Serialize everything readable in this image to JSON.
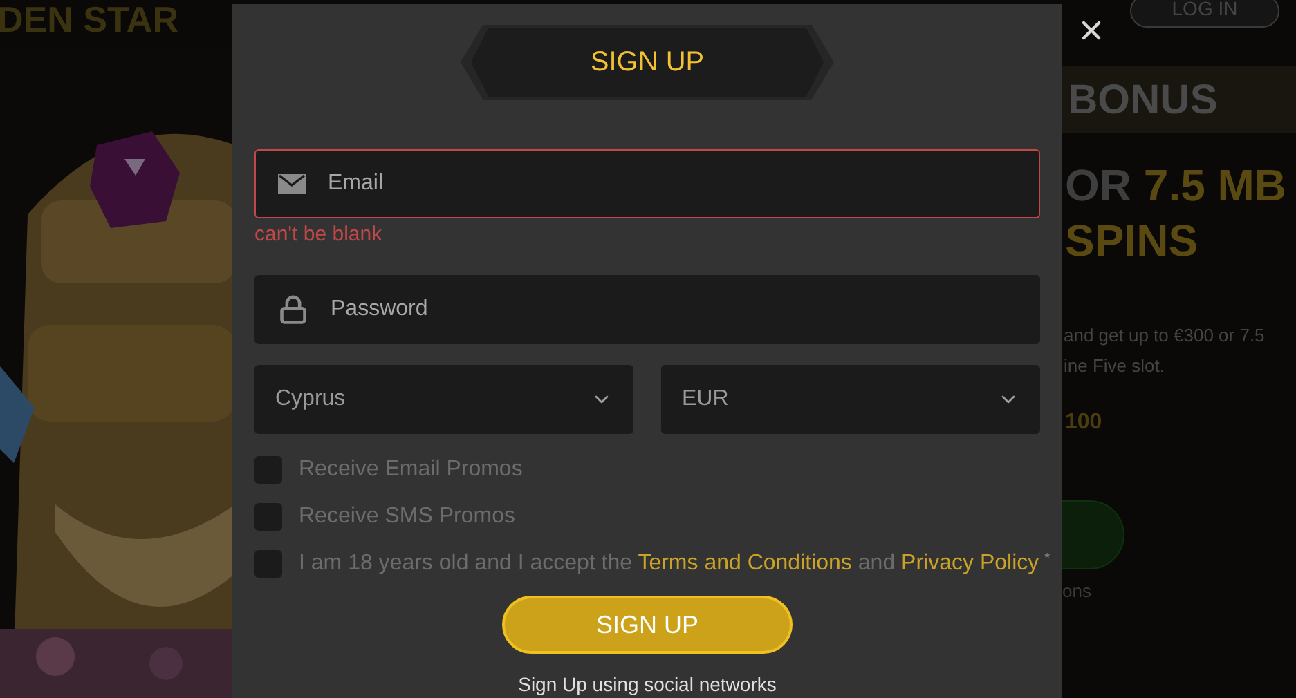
{
  "header": {
    "logo": "DEN STAR",
    "login_button": "LOG IN"
  },
  "promo": {
    "title": "BONUS",
    "headline": [
      {
        "text": "OR",
        "highlight": false
      },
      {
        "text": "7.5 MB",
        "highlight": true
      }
    ],
    "headline_2": "SPINS",
    "description": [
      "and get up to €300 or 7.5",
      "ine Five slot."
    ],
    "amount": "100",
    "footer": "ons"
  },
  "modal": {
    "title": "SIGN UP",
    "fields": [
      {
        "kind": "email",
        "placeholder": "Email",
        "error": "can't be blank"
      },
      {
        "kind": "password",
        "placeholder": "Password"
      }
    ],
    "selects": [
      {
        "value": "Cyprus"
      },
      {
        "value": "EUR"
      }
    ],
    "checkboxes": [
      {
        "checked": false,
        "parts": [
          {
            "kind": "text",
            "text": "Receive Email Promos"
          }
        ]
      },
      {
        "checked": false,
        "parts": [
          {
            "kind": "text",
            "text": "Receive SMS Promos"
          }
        ]
      },
      {
        "checked": false,
        "required": "*",
        "parts": [
          {
            "kind": "text",
            "text": "I am 18 years old and I accept the"
          },
          {
            "kind": "link",
            "text": "Terms and Conditions"
          },
          {
            "kind": "text",
            "text": "and"
          },
          {
            "kind": "link",
            "text": "Privacy Policy"
          }
        ]
      }
    ],
    "submit": "SIGN UP",
    "social_label": "Sign Up using social networks"
  }
}
